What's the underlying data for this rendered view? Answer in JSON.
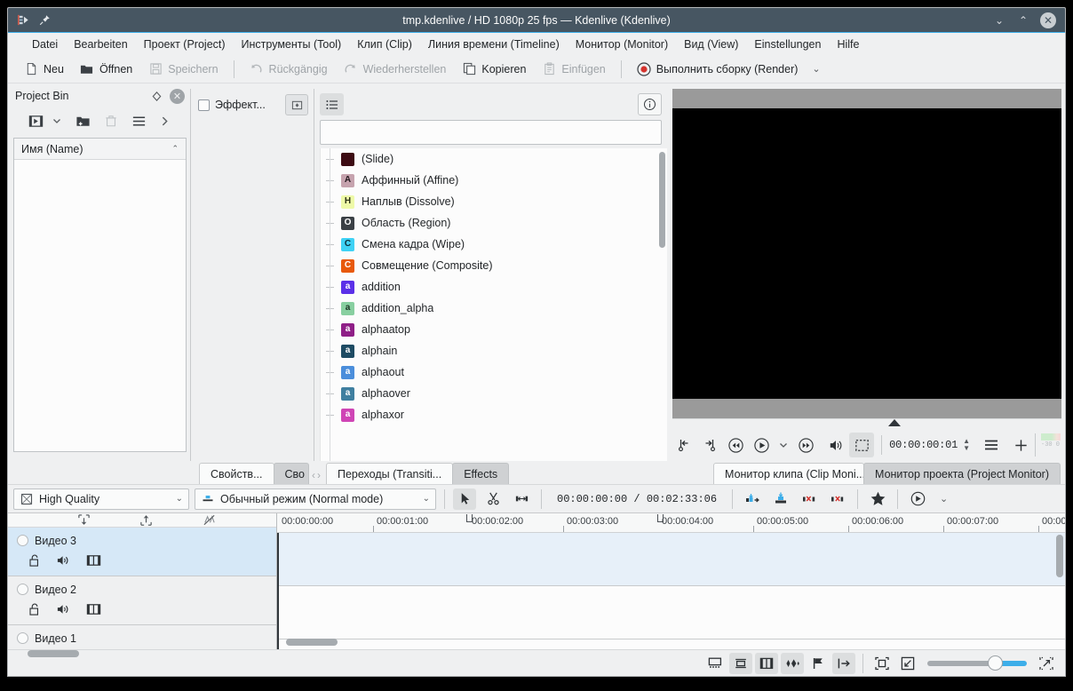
{
  "window": {
    "title": "tmp.kdenlive / HD 1080p 25 fps — Kdenlive (Kdenlive)",
    "minimize": "⌄",
    "maximize": "⌃",
    "close": "✕"
  },
  "menubar": {
    "items": [
      {
        "label": "Datei"
      },
      {
        "label": "Bearbeiten"
      },
      {
        "label": "Проект (Project)"
      },
      {
        "label": "Инструменты (Tool)"
      },
      {
        "label": "Клип (Clip)"
      },
      {
        "label": "Линия времени (Timeline)"
      },
      {
        "label": "Монитор (Monitor)"
      },
      {
        "label": "Вид (View)"
      },
      {
        "label": "Einstellungen"
      },
      {
        "label": "Hilfe"
      }
    ]
  },
  "main_toolbar": {
    "new_label": "Neu",
    "open_label": "Öffnen",
    "save_label": "Speichern",
    "undo_label": "Rückgängig",
    "redo_label": "Wiederherstellen",
    "copy_label": "Kopieren",
    "paste_label": "Einfügen",
    "render_label": "Выполнить сборку (Render)",
    "render_more": "⌄"
  },
  "project_bin": {
    "title": "Project Bin",
    "column_header": "Имя (Name)",
    "sort_arrow": "⌃",
    "float_icon": "◇",
    "close_icon": "✕"
  },
  "effect_stack": {
    "checkbox_checked": false,
    "label": "Эффект...",
    "button_icon": "keyframe-icon"
  },
  "effects_list": {
    "view_icon": "list-view-icon",
    "info_icon": "info-icon",
    "search_value": "",
    "search_placeholder": "",
    "items": [
      {
        "badge": "",
        "color": "#3d0b13",
        "name": "(Slide)"
      },
      {
        "badge": "A",
        "color": "#c6a3ae",
        "name": "Аффинный (Affine)"
      },
      {
        "badge": "H",
        "color": "#eef9a8",
        "name": "Наплыв (Dissolve)"
      },
      {
        "badge": "O",
        "color": "#3b4045",
        "name": "Область (Region)"
      },
      {
        "badge": "C",
        "color": "#3fd2f5",
        "name": "Смена кадра (Wipe)"
      },
      {
        "badge": "C",
        "color": "#e8590c",
        "name": "Совмещение (Composite)"
      },
      {
        "badge": "a",
        "color": "#5b30e8",
        "name": "addition"
      },
      {
        "badge": "a",
        "color": "#88cfa0",
        "name": "addition_alpha"
      },
      {
        "badge": "a",
        "color": "#8f1f87",
        "name": "alphaatop"
      },
      {
        "badge": "a",
        "color": "#1e4b63",
        "name": "alphain"
      },
      {
        "badge": "a",
        "color": "#4b8edb",
        "name": "alphaout"
      },
      {
        "badge": "a",
        "color": "#3f7fa0",
        "name": "alphaover"
      },
      {
        "badge": "a",
        "color": "#cf45b5",
        "name": "alphaxor"
      }
    ]
  },
  "monitor": {
    "timecode": "00:00:00:01",
    "audio_meter_label": "-30 0",
    "buttons": [
      {
        "name": "set-zone-start-icon"
      },
      {
        "name": "set-zone-end-icon"
      },
      {
        "name": "rewind-icon"
      },
      {
        "name": "play-icon"
      },
      {
        "name": "play-menu-chevron-icon"
      },
      {
        "name": "forward-icon"
      },
      {
        "name": "volume-icon"
      },
      {
        "name": "zone-select-icon"
      }
    ],
    "menu_icon": "hamburger-icon",
    "add-icon": "plus-icon",
    "tabs": [
      {
        "label": "Монитор клипа (Clip Moni...",
        "selected": false
      },
      {
        "label": "Монитор проекта (Project Monitor)",
        "selected": true
      }
    ]
  },
  "bottom_tabs": {
    "nav_prev": "‹",
    "nav_next": "›",
    "tabs": [
      {
        "label": "Свойств...",
        "selected": false
      },
      {
        "label": "Сво",
        "selected": true
      },
      {
        "label": "Переходы (Transiti...",
        "selected": false
      },
      {
        "label": "Effects",
        "selected": true
      }
    ]
  },
  "timeline_toolbar": {
    "quality": "High Quality",
    "quality_icon": "quality-icon",
    "quality_arrow": "⌄",
    "mode": "Обычный режим (Normal mode)",
    "mode_icon": "normal-mode-icon",
    "mode_arrow": "⌄",
    "tools": [
      {
        "name": "selection-tool-icon",
        "active": true
      },
      {
        "name": "razor-tool-icon",
        "active": false
      },
      {
        "name": "spacer-tool-icon",
        "active": false
      }
    ],
    "position_timecode": "00:00:00:00",
    "duration_timecode": "00:02:33:06",
    "timecode_separator": "/",
    "edit_buttons": [
      {
        "name": "insert-zone-icon"
      },
      {
        "name": "overwrite-zone-icon"
      },
      {
        "name": "extract-zone-icon"
      },
      {
        "name": "lift-zone-icon"
      }
    ],
    "favorites_icon": "star-icon",
    "preview_icon": "timeline-preview-icon",
    "preview_arrow": "⌄"
  },
  "timeline": {
    "head_toolbar_icons": [
      {
        "name": "track-height-down-icon"
      },
      {
        "name": "track-height-up-icon"
      },
      {
        "name": "mix-disabled-icon"
      }
    ],
    "ruler_labels": [
      "00:00:00:00",
      "00:00:01:00",
      "00:00:02:00",
      "00:00:03:00",
      "00:00:04:00",
      "00:00:05:00",
      "00:00:06:00",
      "00:00:07:00",
      "00:00:"
    ],
    "tracks": [
      {
        "name": "Видео 3",
        "selected": true,
        "icons": [
          "lock-open-icon",
          "audio-on-icon",
          "video-on-icon"
        ]
      },
      {
        "name": "Видео 2",
        "selected": false,
        "icons": [
          "lock-open-icon",
          "audio-on-icon",
          "video-on-icon"
        ]
      },
      {
        "name": "Видео 1",
        "selected": false,
        "icons": []
      }
    ]
  },
  "statusbar": {
    "buttons": [
      {
        "name": "show-markers-icon",
        "active": false
      },
      {
        "name": "show-thumbnails-icon",
        "active": true
      },
      {
        "name": "show-video-thumbs-icon",
        "active": true
      },
      {
        "name": "show-audio-thumbs-icon",
        "active": true
      },
      {
        "name": "show-markers-flag-icon",
        "active": false
      },
      {
        "name": "snap-icon",
        "active": true
      },
      {
        "name": "fit-zoom-icon",
        "active": false
      },
      {
        "name": "zoom-out-icon",
        "active": false
      },
      {
        "name": "zoom-in-icon",
        "active": false
      }
    ],
    "zoom_value": 72
  },
  "colors": {
    "accent": "#3daee9",
    "titlebar": "#475662",
    "chrome": "#eff0f1",
    "selected_track": "#d6e8f7"
  }
}
